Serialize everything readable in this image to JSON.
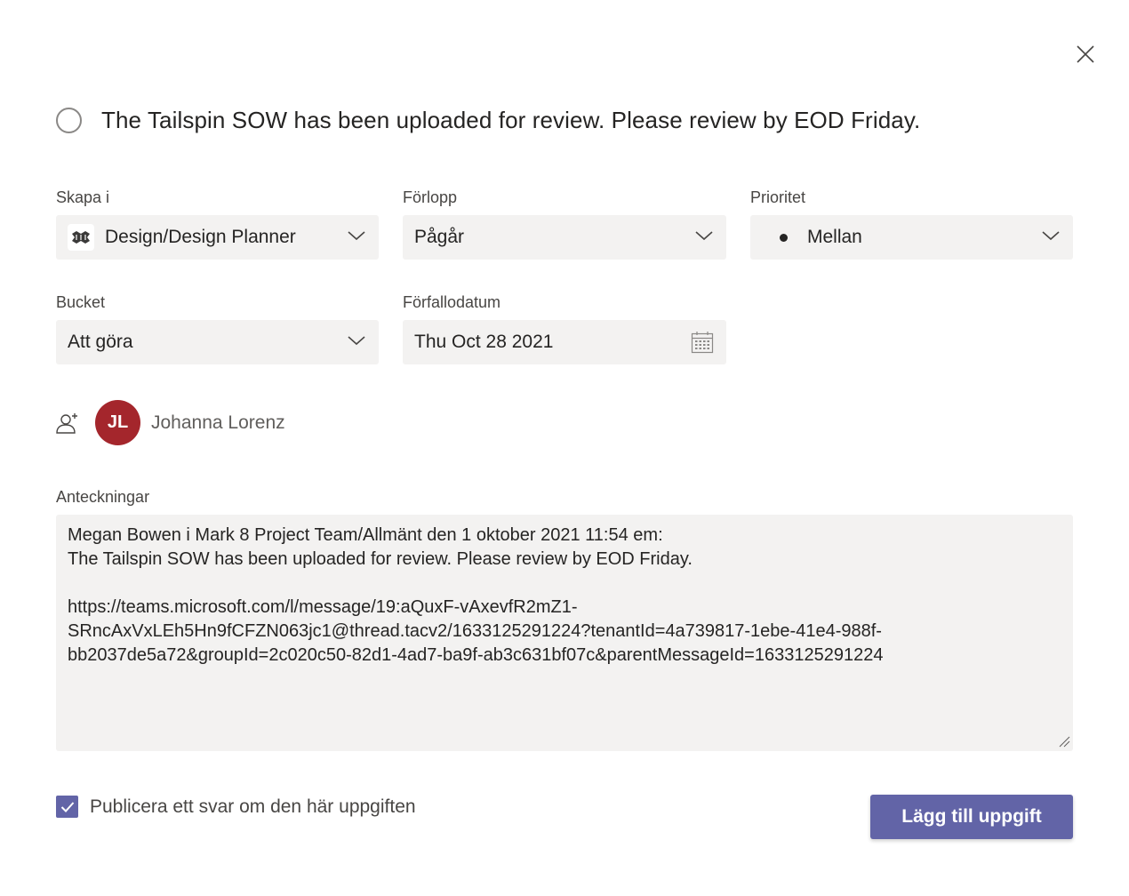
{
  "task": {
    "title": "The Tailspin SOW has been uploaded for review. Please review by EOD Friday."
  },
  "fields": {
    "create_in": {
      "label": "Skapa i",
      "value": "Design/Design Planner"
    },
    "progress": {
      "label": "Förlopp",
      "value": "Pågår"
    },
    "priority": {
      "label": "Prioritet",
      "value": "Mellan"
    },
    "bucket": {
      "label": "Bucket",
      "value": "Att göra"
    },
    "due_date": {
      "label": "Förfallodatum",
      "value": "Thu Oct 28 2021"
    }
  },
  "assignee": {
    "initials": "JL",
    "name": "Johanna Lorenz",
    "avatar_color": "#a4262c"
  },
  "notes": {
    "label": "Anteckningar",
    "text": "Megan Bowen i Mark 8 Project Team/Allmänt den 1 oktober 2021 11:54 em:\nThe Tailspin SOW has been uploaded for review. Please review by EOD Friday.\n\nhttps://teams.microsoft.com/l/message/19:aQuxF-vAxevfR2mZ1-\nSRncAxVxLEh5Hn9fCFZN063jc1@thread.tacv2/1633125291224?tenantId=4a739817-1ebe-41e4-988f-\nbb2037de5a72&groupId=2c020c50-82d1-4ad7-ba9f-ab3c631bf07c&parentMessageId=1633125291224"
  },
  "footer": {
    "post_reply_label": "Publicera ett svar om den här uppgiften",
    "post_reply_checked": true,
    "add_task_label": "Lägg till uppgift"
  },
  "colors": {
    "accent": "#6264a7",
    "field_bg": "#f3f2f1"
  },
  "icons": {
    "close": "close-icon",
    "complete": "circle-icon",
    "chevron": "chevron-down-icon",
    "calendar": "calendar-icon",
    "assign": "add-person-icon",
    "planner": "planner-icon",
    "check": "checkmark-icon"
  }
}
